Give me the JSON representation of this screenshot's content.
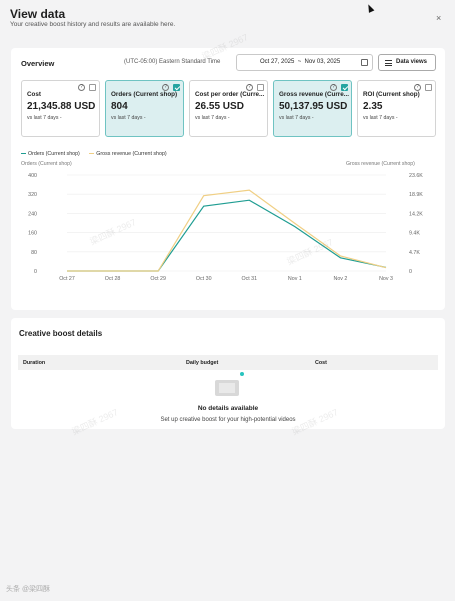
{
  "header": {
    "title": "View data",
    "subtitle": "Your creative boost history and results are available here.",
    "close_label": "×"
  },
  "overview": {
    "title": "Overview",
    "timezone": "(UTC-05:00) Eastern Standard Time",
    "date_range": "Oct 27, 2025  ~  Nov 03, 2025",
    "data_views_label": "Data views",
    "metrics": [
      {
        "label": "Cost",
        "value": "21,345.88 USD",
        "compare": "vs last 7 days -",
        "selected": false
      },
      {
        "label": "Orders (Current shop)",
        "value": "804",
        "compare": "vs last 7 days -",
        "selected": true
      },
      {
        "label": "Cost per order (Curre...",
        "value": "26.55 USD",
        "compare": "vs last 7 days -",
        "selected": false
      },
      {
        "label": "Gross revenue (Curre...",
        "value": "50,137.95 USD",
        "compare": "vs last 7 days -",
        "selected": true
      },
      {
        "label": "ROI (Current shop)",
        "value": "2.35",
        "compare": "vs last 7 days -",
        "selected": false
      }
    ]
  },
  "chart_data": {
    "type": "line",
    "categories": [
      "Oct 27",
      "Oct 28",
      "Oct 29",
      "Oct 30",
      "Oct 31",
      "Nov 1",
      "Nov 2",
      "Nov 3"
    ],
    "series": [
      {
        "name": "Orders (Current shop)",
        "axis": "left",
        "color": "#1f9d92",
        "values": [
          0,
          0,
          0,
          270,
          295,
          185,
          55,
          15
        ]
      },
      {
        "name": "Gross revenue (Current shop)",
        "axis": "right",
        "color": "#f0cf84",
        "values": [
          0,
          0,
          0,
          18500,
          19900,
          11700,
          3700,
          800
        ]
      }
    ],
    "ylabel_left": "Orders (Current shop)",
    "ylabel_right": "Gross revenue (Current shop)",
    "y_left_ticks": [
      "0",
      "80",
      "160",
      "240",
      "320",
      "400"
    ],
    "y_right_ticks": [
      "0",
      "4.7K",
      "9.4K",
      "14.2K",
      "18.9K",
      "23.6K"
    ],
    "ylim_left": [
      0,
      400
    ],
    "ylim_right": [
      0,
      23600
    ],
    "grid": true,
    "legend": "top-left"
  },
  "details": {
    "title": "Creative boost details",
    "columns": [
      "Duration",
      "Daily budget",
      "Cost"
    ],
    "empty_title": "No details available",
    "empty_subtitle": "Set up creative boost for your high-potential videos"
  },
  "watermark": "梁四酥 2967",
  "corner_watermark": "头条 @梁四酥"
}
